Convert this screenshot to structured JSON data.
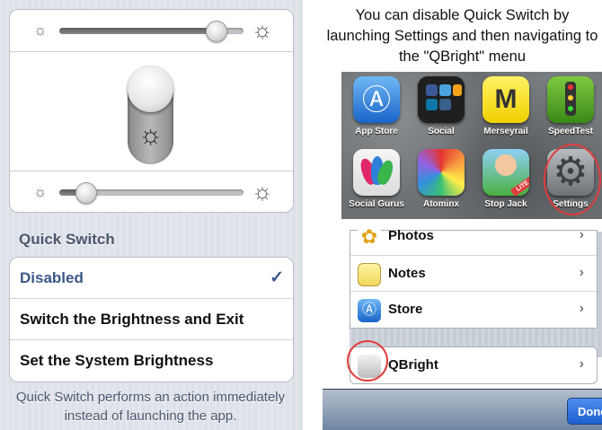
{
  "left": {
    "section_label": "Quick Switch",
    "options": [
      {
        "label": "Disabled",
        "selected": true,
        "check": "✓"
      },
      {
        "label": "Switch the Brightness and Exit",
        "selected": false
      },
      {
        "label": "Set the System Brightness",
        "selected": false
      }
    ],
    "footer_note": "Quick Switch performs an action immediately instead of launching the app.",
    "top_slider_level": 0.85,
    "bottom_slider_level": 0.14,
    "switch_icon": "sun-icon"
  },
  "right": {
    "instructions": "You can disable Quick Switch by launching Settings and then navigating to the \"QBright\" menu",
    "apps": [
      {
        "name": "App Store",
        "icon": "app-store-icon"
      },
      {
        "name": "Social",
        "icon": "social-folder-icon"
      },
      {
        "name": "Merseyrail",
        "icon": "merseyrail-icon"
      },
      {
        "name": "SpeedTest",
        "icon": "speedtest-icon"
      },
      {
        "name": "Social Gurus",
        "icon": "social-gurus-icon"
      },
      {
        "name": "Atominx",
        "icon": "atominx-icon"
      },
      {
        "name": "Stop Jack",
        "icon": "stop-jack-icon"
      },
      {
        "name": "Settings",
        "icon": "settings-gear-icon"
      }
    ],
    "settings_rows": [
      {
        "label": "Photos",
        "icon": "photos-icon"
      },
      {
        "label": "Notes",
        "icon": "notes-icon"
      },
      {
        "label": "Store",
        "icon": "store-icon"
      }
    ],
    "qbright_row": {
      "label": "QBright",
      "icon": "qbright-icon"
    },
    "done_label": "Done",
    "highlight_color": "#e23c3c"
  }
}
